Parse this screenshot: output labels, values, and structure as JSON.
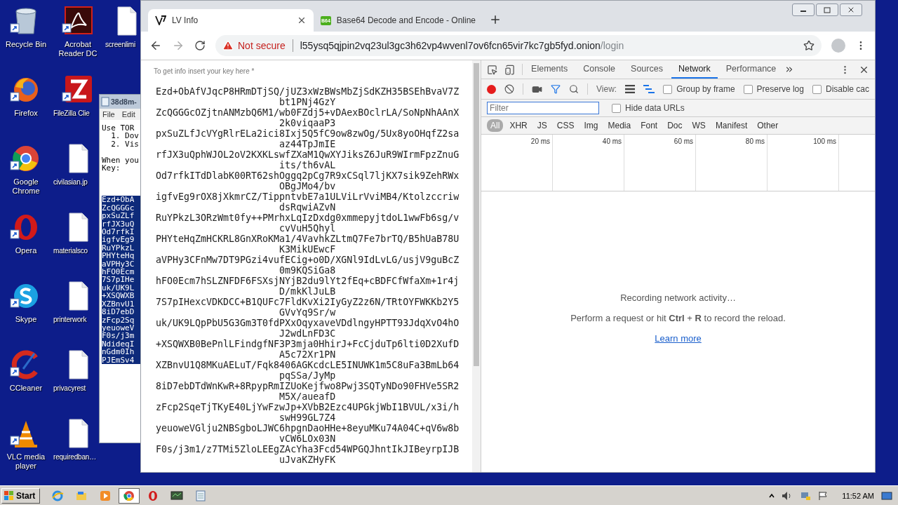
{
  "desktop": {
    "icons": [
      {
        "label": "Recycle Bin",
        "kind": "bin"
      },
      {
        "label": "Firefox",
        "kind": "firefox"
      },
      {
        "label": "Google Chrome",
        "kind": "chrome"
      },
      {
        "label": "Opera",
        "kind": "opera"
      },
      {
        "label": "Skype",
        "kind": "skype"
      },
      {
        "label": "CCleaner",
        "kind": "ccleaner"
      },
      {
        "label": "VLC media player",
        "kind": "vlc"
      },
      {
        "label": "Acrobat Reader DC",
        "kind": "pdf"
      },
      {
        "label": "FileZilla Clie",
        "kind": "filezilla"
      },
      {
        "label": "civilasian.jp",
        "kind": "file"
      },
      {
        "label": "materialsco",
        "kind": "file"
      },
      {
        "label": "printerwork",
        "kind": "file"
      },
      {
        "label": "privacyrest",
        "kind": "file"
      },
      {
        "label": "requiredban…",
        "kind": "file"
      },
      {
        "label": "screenlimi",
        "kind": "file"
      }
    ]
  },
  "notepad": {
    "title": "38d8m-",
    "menu": [
      "File",
      "Edit"
    ],
    "lines": [
      "Use TOR",
      "  1. Dov",
      "  2. Vis"
    ],
    "lines_after": [
      "When you",
      "Key:"
    ],
    "selected_lines": [
      "Ezd+ObA",
      "ZcQGGGc",
      "pxSuZLf",
      "rfJX3uQ",
      "Od7rfkI",
      "igfvEg9",
      "RuYPkzL",
      "PHYteHq",
      "aVPHy3C",
      "hFO0Ecm",
      "7S7pIHe",
      "uk/UK9L",
      "+XSQWXB",
      "XZBnvU1",
      "8iD7ebD",
      "zFcp2Sq",
      "yeuoweV",
      "F0s/j3m",
      "NdideqI",
      "nGdm0Ih",
      "PJEmSv4"
    ]
  },
  "browser": {
    "tabs": [
      {
        "title": "LV Info",
        "selected": true
      },
      {
        "title": "Base64 Decode and Encode - Online",
        "badge": "B64",
        "selected": false
      }
    ],
    "address": {
      "warning": "Not secure",
      "host": "l55ysq5qjpin2vq23ul3gc3h62vp4wvenl7ov6fcn65vir7kc7gb5fyd.onion",
      "path": "/login"
    },
    "page": {
      "label": "To get info insert your key here *",
      "key_lines": [
        "Ezd+ObAfVJqcP8HRmDTjSQ/jUZ3xWzBWsMbZjSdKZH35BSEhBvaV7Zbt1PNj4GzY",
        "ZcQGGGcOZjtnANMzbQ6M1/wb0FZdj5+vDAexBOclrLA/SoNpNhAAnX2k0viqaaP3",
        "pxSuZLfJcVYgRlrELa2ici8Ixj5Q5fC9ow8zwOg/5Ux8yoOHqfZ2saaz44TpJmIE",
        "rfJX3uQphWJOL2oV2KXKLswfZXaM1QwXYJiksZ6JuR9WIrmFpzZnuGits/th6vAL",
        "Od7rfkITdDlabK00RT62shOggq2pCg7R9xCSql7ljKX7sik9ZehRWxOBgJMo4/bv",
        "igfvEg9rOX8jXkmrCZ/TippntvbE7a1ULViLrVviMB4/KtolzccriwdsRqwiAZvN",
        "RuYPkzL3ORzWmt0fy++PMrhxLqIzDxdg0xmmepyjtdoL1wwFb6sg/vcvVuH5Qhyl",
        "PHYteHqZmHCKRL8GnXRoKMa1/4VavhkZLtmQ7Fe7brTQ/B5hUaB78UK3MikUEwcF",
        "aVPHy3CFnMw7DT9PGzi4vufECig+o0D/XGNl9IdLvLG/usjV9guBcZ0m9KQSiGa8",
        "hFO0Ecm7hSLZNFDF6FSXsjNYjB2du9lYt2fEq+cBDFCfWfaXm+1r4jD/mkKlJuLB",
        "7S7pIHexcVDKDCC+B1QUFc7FldKvXi2IyGyZ2z6N/TRtOYFWKKb2Y5GVvYq9Sr/w",
        "uk/UK9LQpPbU5G3Gm3T0fdPXxOqyxaveVDdlngyHPTT93JdqXvO4hOJ2wdLnFD3C",
        "+XSQWXB0BePnlLFindgfNF3P3mja0HhirJ+FcCjduTp6lti0D2XufDA5c72Xr1PN",
        "XZBnvU1Q8MKuAELuT/Fqk8406AGKcdcLE5INUWK1m5C8uFa3BmLb64pqSSa/JyMp",
        "8iD7ebDTdWnKwR+8RpypRmIZUoKejfwo8Pwj3SQTyNDo90FHVe5SR2M5X/aueafD",
        "zFcp2SqeTjTKyE40LjYwFzwJp+XVbB2Ezc4UPGkjWbI1BVUL/x3i/hswH99GL7Z4",
        "yeuoweVGlju2NBSgboLJWC6hpgnDaoHHe+8eyuMKu74A04C+qV6w8bvCW6LOx03N",
        "F0s/j3m1/z7TMi5ZloLEEgZAcYha3Fcd54WPGQJhntIkJIBeyrpIJBuJvaKZHyFK"
      ]
    },
    "devtools": {
      "tabs": [
        {
          "label": "Elements",
          "selected": false
        },
        {
          "label": "Console",
          "selected": false
        },
        {
          "label": "Sources",
          "selected": false
        },
        {
          "label": "Network",
          "selected": true
        },
        {
          "label": "Performance",
          "selected": false
        }
      ],
      "recording": true,
      "filter_active": true,
      "view_label": "View:",
      "options": [
        {
          "label": "Group by frame",
          "checked": false
        },
        {
          "label": "Preserve log",
          "checked": false
        },
        {
          "label": "Disable cac",
          "checked": false
        }
      ],
      "filter": {
        "placeholder": "Filter"
      },
      "hide_data_urls": {
        "label": "Hide data URLs",
        "checked": false
      },
      "types": [
        {
          "label": "All",
          "selected": true
        },
        {
          "label": "XHR",
          "selected": false
        },
        {
          "label": "JS",
          "selected": false
        },
        {
          "label": "CSS",
          "selected": false
        },
        {
          "label": "Img",
          "selected": false
        },
        {
          "label": "Media",
          "selected": false
        },
        {
          "label": "Font",
          "selected": false
        },
        {
          "label": "Doc",
          "selected": false
        },
        {
          "label": "WS",
          "selected": false
        },
        {
          "label": "Manifest",
          "selected": false
        },
        {
          "label": "Other",
          "selected": false
        }
      ],
      "ticks": [
        "20 ms",
        "40 ms",
        "60 ms",
        "80 ms",
        "100 ms"
      ],
      "status": "Recording network activity…",
      "hint": "Perform a request or hit **Ctrl** + **R** to record the reload.",
      "link": "Learn more"
    }
  },
  "taskbar": {
    "start": "Start",
    "apps": [
      {
        "kind": "ie",
        "selected": false
      },
      {
        "kind": "folder",
        "selected": false
      },
      {
        "kind": "media",
        "selected": false
      },
      {
        "kind": "chrome",
        "selected": true
      },
      {
        "kind": "opera",
        "selected": false
      },
      {
        "kind": "monitor",
        "selected": false
      },
      {
        "kind": "notepad",
        "selected": false
      }
    ],
    "clock": "11:52 AM"
  }
}
